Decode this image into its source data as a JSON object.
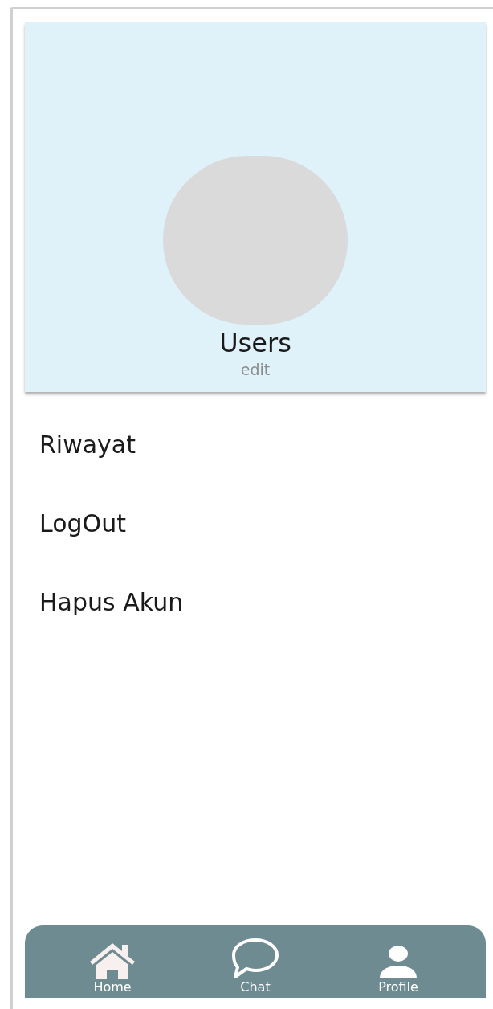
{
  "profile": {
    "name": "Users",
    "edit_label": "edit"
  },
  "menu": [
    {
      "label": "Riwayat"
    },
    {
      "label": "LogOut"
    },
    {
      "label": "Hapus Akun"
    }
  ],
  "nav": [
    {
      "kind": "home",
      "label": "Home"
    },
    {
      "kind": "chat",
      "label": "Chat"
    },
    {
      "kind": "profile",
      "label": "Profile"
    }
  ]
}
